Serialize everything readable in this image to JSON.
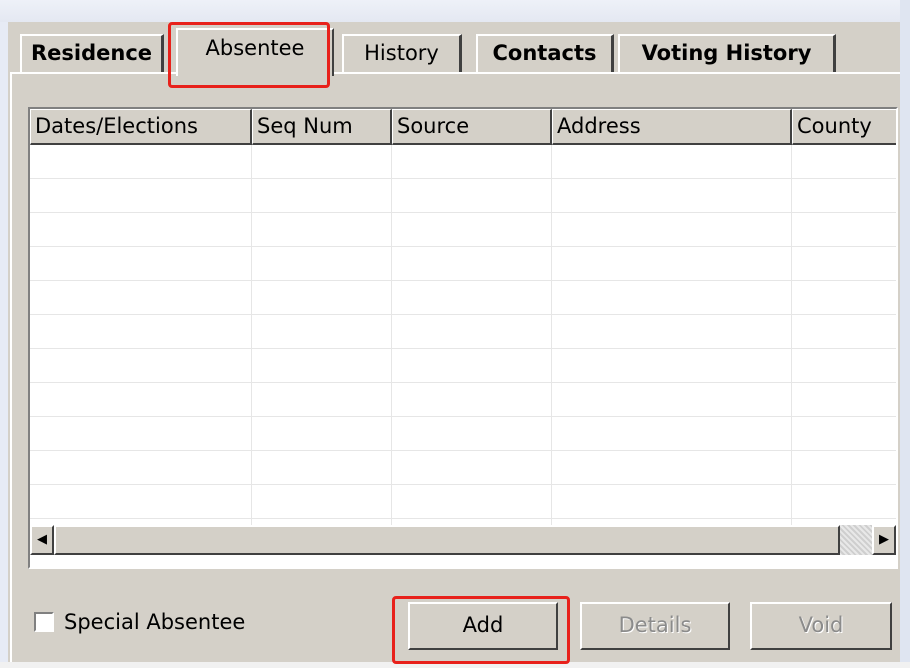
{
  "tabs": [
    {
      "label": "Residence",
      "active": false,
      "bold": true
    },
    {
      "label": "Absentee",
      "active": true,
      "bold": false
    },
    {
      "label": "History",
      "active": false,
      "bold": false
    },
    {
      "label": "Contacts",
      "active": false,
      "bold": true
    },
    {
      "label": "Voting History",
      "active": false,
      "bold": true
    }
  ],
  "table": {
    "columns": [
      "Dates/Elections",
      "Seq Num",
      "Source",
      "Address",
      "County"
    ],
    "rows": []
  },
  "scrollbar": {
    "left_arrow": "◀",
    "right_arrow": "▶"
  },
  "special_absentee": {
    "label": "Special Absentee",
    "checked": false
  },
  "buttons": {
    "add": "Add",
    "details": "Details",
    "void": "Void"
  },
  "colors": {
    "panel_bg": "#d4d0c8",
    "highlight": "#e8211b",
    "disabled_text": "#8b8b8b"
  }
}
